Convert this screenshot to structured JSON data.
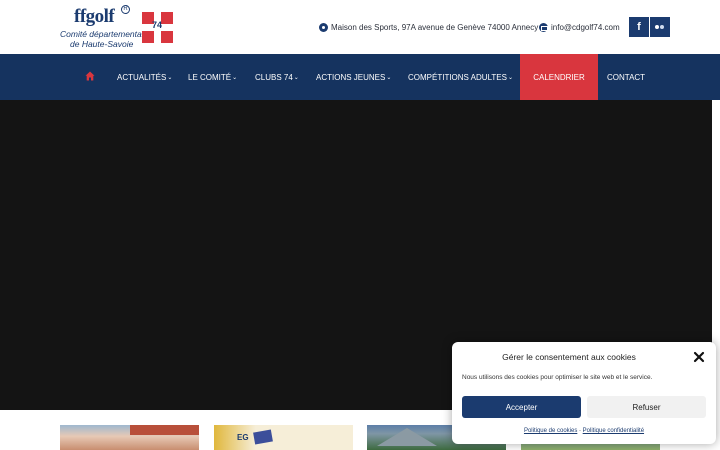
{
  "header": {
    "logo": {
      "wordmark": "ffgolf",
      "registered": "R",
      "line1": "Comité départemental",
      "line2": "de Haute-Savoie",
      "flag_number": "74"
    },
    "address": "Maison des Sports, 97A avenue de Genève 74000 Annecy",
    "email": "info@cdgolf74.com",
    "social": {
      "facebook": "f"
    }
  },
  "nav": {
    "items": [
      {
        "label": "ACTUALITÉS",
        "chevron": "⌄"
      },
      {
        "label": "LE COMITÉ",
        "chevron": "⌄"
      },
      {
        "label": "CLUBS 74",
        "chevron": "⌄"
      },
      {
        "label": "ACTIONS JEUNES",
        "chevron": "⌄"
      },
      {
        "label": "COMPÉTITIONS ADULTES",
        "chevron": "⌄"
      },
      {
        "label": "CALENDRIER"
      },
      {
        "label": "CONTACT"
      }
    ],
    "active_index": 5
  },
  "thumbnails": {
    "t2_text": "EG"
  },
  "cookie": {
    "title": "Gérer le consentement aux cookies",
    "text": "Nous utilisons des cookies pour optimiser le site web et le service.",
    "accept_label": "Accepter",
    "refuse_label": "Refuser",
    "link_cookies": "Politique de cookies",
    "link_separator": "-",
    "link_privacy": "Politique confidentialité"
  },
  "colors": {
    "navy": "#15335f",
    "accent_red": "#d9363e",
    "hero": "#141414"
  }
}
